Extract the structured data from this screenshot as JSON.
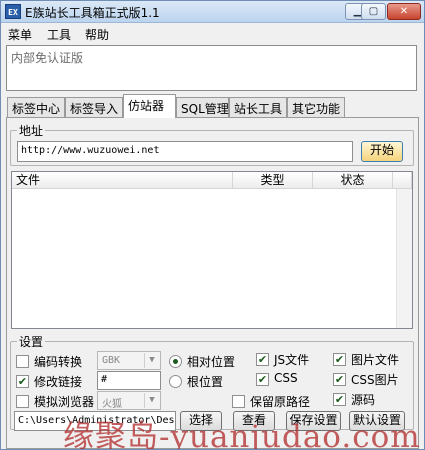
{
  "window": {
    "title": "E族站长工具箱正式版1.1",
    "icon_text": "EX",
    "icon": "app-icon",
    "controls": {
      "minimize": "minimize-icon",
      "maximize": "maximize-icon",
      "close": "close-icon"
    }
  },
  "menu": [
    "菜单",
    "工具",
    "帮助"
  ],
  "info_text": "内部免认证版",
  "tabs": [
    "标签中心",
    "标签导入",
    "仿站器",
    "SQL管理",
    "站长工具",
    "其它功能"
  ],
  "active_tab": "仿站器",
  "address": {
    "legend": "地址",
    "value": "http://www.wuzuowei.net",
    "start_button": "开始"
  },
  "list": {
    "columns": [
      "文件",
      "类型",
      "状态"
    ],
    "rows": []
  },
  "settings": {
    "legend": "设置",
    "encoding_label": "编码转换",
    "encoding_value": "GBK",
    "modify_link_label": "修改链接",
    "modify_link_value": "#",
    "browser_label": "模拟浏览器",
    "browser_value": "火狐",
    "relative_label": "相对位置",
    "root_label": "根位置",
    "keep_path_label": "保留原路径",
    "js_label": "JS文件",
    "css_label": "CSS",
    "image_label": "图片文件",
    "css_image_label": "CSS图片",
    "source_label": "源码",
    "path_value": "C:\\Users\\Administrator\\Desl",
    "buttons": [
      "选择",
      "查看",
      "保存设置",
      "默认设置"
    ]
  },
  "watermark": "缘聚岛-yuanjudao.com"
}
